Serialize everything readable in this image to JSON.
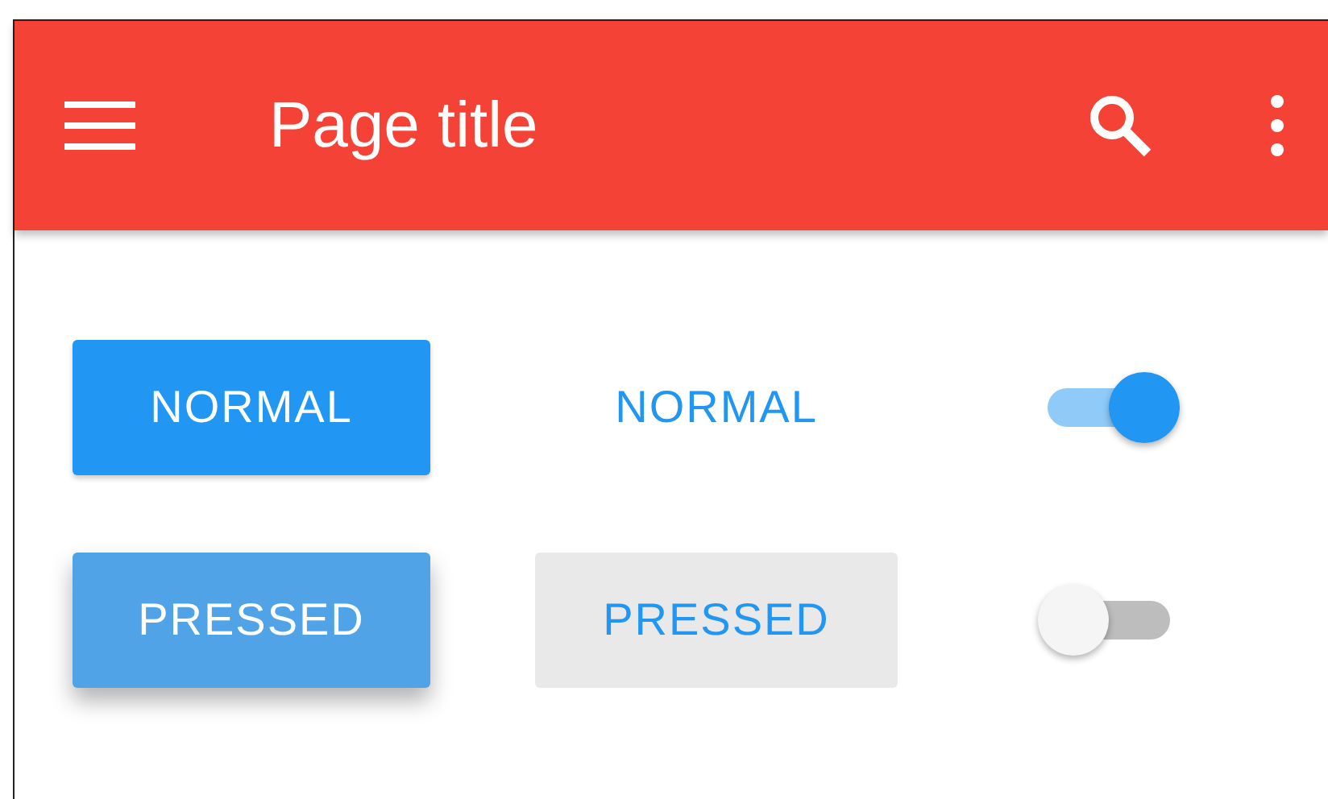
{
  "app_bar": {
    "title": "Page title"
  },
  "rows": [
    {
      "buttons": [
        {
          "kind": "raised",
          "label": "NORMAL",
          "pressed": false
        },
        {
          "kind": "flat",
          "label": "NORMAL",
          "pressed": false
        }
      ],
      "switch": {
        "on": true
      }
    },
    {
      "buttons": [
        {
          "kind": "raised",
          "label": "PRESSED",
          "pressed": true
        },
        {
          "kind": "flat",
          "label": "PRESSED",
          "pressed": true
        }
      ],
      "switch": {
        "on": false
      }
    }
  ]
}
